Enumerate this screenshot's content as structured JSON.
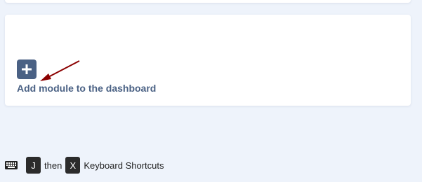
{
  "module_area": {
    "add_label": "Add module to the dashboard",
    "add_icon": "plus-icon",
    "pointer_icon": "arrow-pointer-icon",
    "accent_color": "#4a6184",
    "arrow_color": "#8b0000"
  },
  "footer": {
    "keyboard_icon": "keyboard-icon",
    "key1": "J",
    "connector": "then",
    "key2": "X",
    "label": "Keyboard Shortcuts"
  }
}
